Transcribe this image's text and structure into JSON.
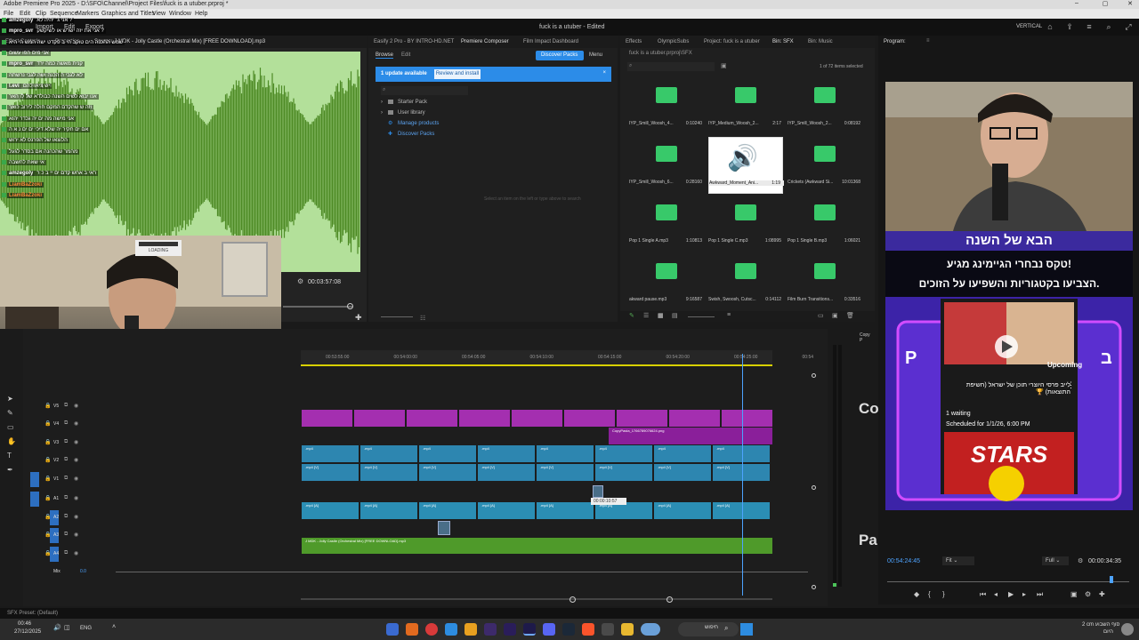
{
  "titlebar": {
    "title": "Adobe Premiere Pro 2025 - D:\\SFO\\Channel\\Project Files\\fuck is a utuber.prproj *",
    "controls": [
      "–",
      "▢",
      "✕"
    ]
  },
  "menubar": {
    "items": [
      "File",
      "Edit",
      "Clip",
      "Sequence",
      "Markers",
      "Graphics and Titles",
      "View",
      "Window",
      "Help"
    ]
  },
  "workspace": {
    "left_tabs": [
      "Import",
      "Edit",
      "Export"
    ],
    "file_title": "fuck is a utuber - Edited",
    "vertical_label": "VERTICAL"
  },
  "source_panel": {
    "tabs": [
      "Effect Controls",
      "Properties",
      "Source: J MDK - Jolly Castle (Orchestral Mix) [FREE DOWNLOAD].mp3"
    ],
    "timecode": "00:03:57:08"
  },
  "chat": {
    "lines": [
      {
        "user": "amzegoly",
        "msg": "אני ג׳ יהיה לא ?"
      },
      {
        "user": "mpro_svr",
        "msg": "אני את יזה ישרש או לשיקשק ?"
      },
      {
        "user": "",
        "msg": "שמש ההכנה הים טוקב הי ב פקדט ישה המש הי היא"
      },
      {
        "user": "",
        "msg": "אני מים הפו עשום"
      },
      {
        "user": "mpro_svr",
        "msg": "קנית מאשה כמה ירד"
      },
      {
        "user": "",
        "msg": "לא לגבי ה הכנה ושה לגבי נרשתה"
      },
      {
        "user": "l.evi",
        "msg": "יש ציאו להם"
      },
      {
        "user": "",
        "msg": "אנו יבוא לשים השנה כבולדא של לו האר"
      },
      {
        "user": "",
        "msg": "וזה ש שהקדם המקם חולה לירוב כואר"
      },
      {
        "user": "",
        "msg": "אני מישה מה ים יה גכדר יהוא"
      },
      {
        "user": "",
        "msg": "אם ים חקיר יה שלא דיכי ים ים נ א ה"
      },
      {
        "user": "",
        "msg": "הלוצאו של הפרנס לא ירוש"
      },
      {
        "user": "",
        "msg": "מהמר שהכהנה אם בסדר לגעל"
      },
      {
        "user": "",
        "msg": "אי שאת לחשבה"
      },
      {
        "user": "amzegoly",
        "msg": "ראי ב אחש קדם ים יי ב כ ר"
      },
      {
        "user": "LiamBaZzoki",
        "msg": ""
      },
      {
        "user": "LiamBaZzoki",
        "msg": ""
      }
    ]
  },
  "webcam": {
    "loading_label": "LOADING"
  },
  "composer": {
    "tabs": [
      "Easify 2 Pro - BY INTRO-HD.NET",
      "Premiere Composer",
      "Film Impact Dashboard"
    ],
    "subtabs": [
      "Browse",
      "Edit"
    ],
    "discover_button": "Discover Packs",
    "menu_label": "Menu",
    "update_text": "1 update available",
    "update_button": "Review and install",
    "tree": [
      "Starter Pack",
      "User library",
      "Manage products",
      "Discover Packs"
    ],
    "hint": "Select an item on the left or type above to search"
  },
  "effects_panel": {
    "tabs": [
      "Effects",
      "OlympicSubs",
      "Project: fuck is a utuber",
      "Bin: SFX",
      "Bin: Music"
    ],
    "path": "fuck is a utuber.prproj\\SFX",
    "selection": "1 of 72 items selected",
    "items": [
      {
        "name": "IYP_Smill_Woosh_4...",
        "dur": "0:10240"
      },
      {
        "name": "IYP_Medium_Woosh_2...",
        "dur": "2:17"
      },
      {
        "name": "IYP_Smill_Woosh_2...",
        "dur": "0:08192"
      },
      {
        "name": "IYP_Smill_Woosh_6...",
        "dur": "0:28160"
      },
      {
        "name": "Awkward_Moment_Ani...",
        "dur": "1:19"
      },
      {
        "name": "Crickets (Awkward Si...",
        "dur": "10:01368"
      },
      {
        "name": "Pop 1 Single A.mp3",
        "dur": "1:10813"
      },
      {
        "name": "Pop 1 Single C.mp3",
        "dur": "1:08995"
      },
      {
        "name": "Pop 1 Single B.mp3",
        "dur": "1:06021"
      },
      {
        "name": "akward pause.mp3",
        "dur": "9:16587"
      },
      {
        "name": "Swish, Swoosh, Cutsc...",
        "dur": "0:14112"
      },
      {
        "name": "Film Burn Transitions...",
        "dur": "0:33516"
      }
    ]
  },
  "program": {
    "title": "Program: ",
    "heading": "הבא של השנה",
    "line1": "טקס נבחרי הגיימינג מגיע!",
    "line2": "הצביעו בקטגוריות והשפיעו על הזוכים.",
    "upcoming": "Upcoming",
    "video_title": "לייב פרסי היוצרי תוכן של ישראל (חשיפת התוצאות) 🏆",
    "waiting": "1 waiting",
    "scheduled": "Scheduled for 1/1/26, 6:00 PM",
    "stars": "STARS",
    "letter_p": "P",
    "letter_b": "ב",
    "side_co": "Co",
    "side_pa": "Pa",
    "timecode": "00:54:24:45",
    "fit": "Fit",
    "full": "Full",
    "duration": "00:00:34:35",
    "loading": "LOADING"
  },
  "timeline": {
    "ruler_times": [
      "00:53:55:00",
      "00:54:00:00",
      "00:54:05:00",
      "00:54:10:00",
      "00:54:15:00",
      "00:54:20:00",
      "00:54:25:00",
      "00:54"
    ],
    "tracks": [
      "V5",
      "V4",
      "V3",
      "V2",
      "V1",
      "A1",
      "A2",
      "A3",
      "A4",
      "Mix"
    ],
    "mix_value": "0.0",
    "clip_v3_label": "CopyPasta_1766789076624.png",
    "clip_v_label": ".mp4",
    "clip_v1_label": ".mp4 [V]",
    "clip_a2_label": ".mp4 [A]",
    "clip_a4_label": "J MDK - Jolly Castle (Orchestral Mix) [FREE DOWNLOAD].mp3",
    "tooltip": "00:00:10:57",
    "copy_label": "Copy P"
  },
  "status": {
    "text": "SFX Preset: (Default)"
  },
  "taskbar": {
    "time": "00:46",
    "date": "27/12/2025",
    "lang": "ENG",
    "search": "חיפוש",
    "weather": "2 cm סוף השבוע",
    "weather_sub": "היום"
  }
}
